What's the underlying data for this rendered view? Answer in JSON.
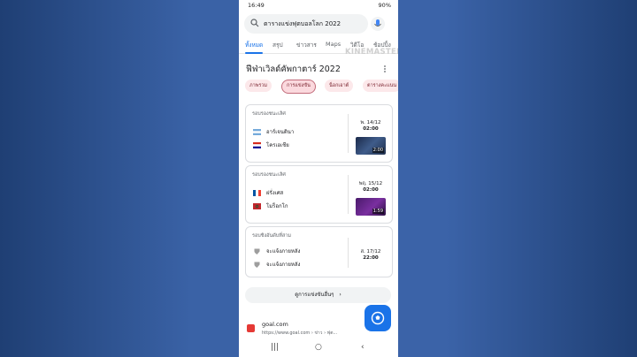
{
  "status": {
    "time": "16:49",
    "battery": "90%"
  },
  "search": {
    "query": "ตารางแข่งฟุตบอลโลก 2022"
  },
  "watermark": "KINEMASTER",
  "tabs": [
    {
      "label": "ทั้งหมด",
      "active": true
    },
    {
      "label": "สรุป"
    },
    {
      "label": "ข่าวสาร"
    },
    {
      "label": "Maps"
    },
    {
      "label": "วิดีโอ"
    },
    {
      "label": "ช้อปปิ้ง"
    }
  ],
  "section_title": "ฟีฟ่าเวิลด์คัพกาตาร์ 2022",
  "chips": [
    {
      "label": "ภาพรวม"
    },
    {
      "label": "การแข่งขัน",
      "selected": true
    },
    {
      "label": "น็อกเอาต์"
    },
    {
      "label": "ตารางคะแนน"
    }
  ],
  "matches": [
    {
      "stage": "รอบรองชนะเลิศ",
      "team1": "อาร์เจนตินา",
      "team2": "โครเอเชีย",
      "date": "พ. 14/12",
      "time": "02:00",
      "video_duration": "2:00"
    },
    {
      "stage": "รอบรองชนะเลิศ",
      "team1": "ฝรั่งเศส",
      "team2": "โมร็อกโก",
      "date": "พฤ. 15/12",
      "time": "02:00",
      "video_duration": "1:59"
    },
    {
      "stage": "รอบชิงอันดับที่สาม",
      "team1": "จะแจ้งภายหลัง",
      "team2": "จะแจ้งภายหลัง",
      "date": "ส. 17/12",
      "time": "22:00"
    }
  ],
  "more_button": "ดูการแข่งขันอื่นๆ",
  "result": {
    "site": "goal.com",
    "url": "https://www.goal.com › ข่าว › ฟุต..."
  },
  "colors": {
    "accent": "#1a73e8",
    "chip_bg": "#fce8ea",
    "chip_text": "#7b2430",
    "background": "#3b63a8"
  }
}
